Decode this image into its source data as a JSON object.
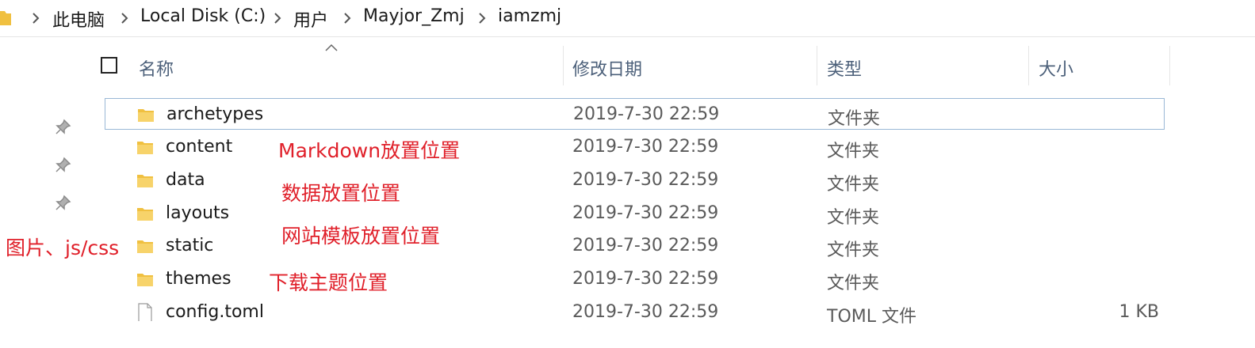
{
  "breadcrumb": [
    "此电脑",
    "Local Disk (C:)",
    "用户",
    "Mayjor_Zmj",
    "iamzmj"
  ],
  "columns": {
    "name": "名称",
    "date": "修改日期",
    "type": "类型",
    "size": "大小"
  },
  "rows": [
    {
      "name": "archetypes",
      "date": "2019-7-30 22:59",
      "type": "文件夹",
      "size": "",
      "kind": "folder",
      "selected": true
    },
    {
      "name": "content",
      "date": "2019-7-30 22:59",
      "type": "文件夹",
      "size": "",
      "kind": "folder"
    },
    {
      "name": "data",
      "date": "2019-7-30 22:59",
      "type": "文件夹",
      "size": "",
      "kind": "folder"
    },
    {
      "name": "layouts",
      "date": "2019-7-30 22:59",
      "type": "文件夹",
      "size": "",
      "kind": "folder"
    },
    {
      "name": "static",
      "date": "2019-7-30 22:59",
      "type": "文件夹",
      "size": "",
      "kind": "folder"
    },
    {
      "name": "themes",
      "date": "2019-7-30 22:59",
      "type": "文件夹",
      "size": "",
      "kind": "folder"
    },
    {
      "name": "config.toml",
      "date": "2019-7-30 22:59",
      "type": "TOML 文件",
      "size": "1 KB",
      "kind": "file"
    }
  ],
  "annotations": {
    "content": "Markdown放置位置",
    "data": "数据放置位置",
    "layouts": "网站模板放置位置",
    "static": "图片、js/css",
    "themes": "下载主题位置"
  },
  "colors": {
    "annotation": "#e0202a",
    "folder": "#f0c040",
    "header_text": "#4c607a",
    "selection_border": "#99b8d6"
  },
  "icons": {
    "folder": "folder-icon",
    "file": "file-icon",
    "pin": "pin-icon",
    "chevron": "chevron-right-icon"
  }
}
